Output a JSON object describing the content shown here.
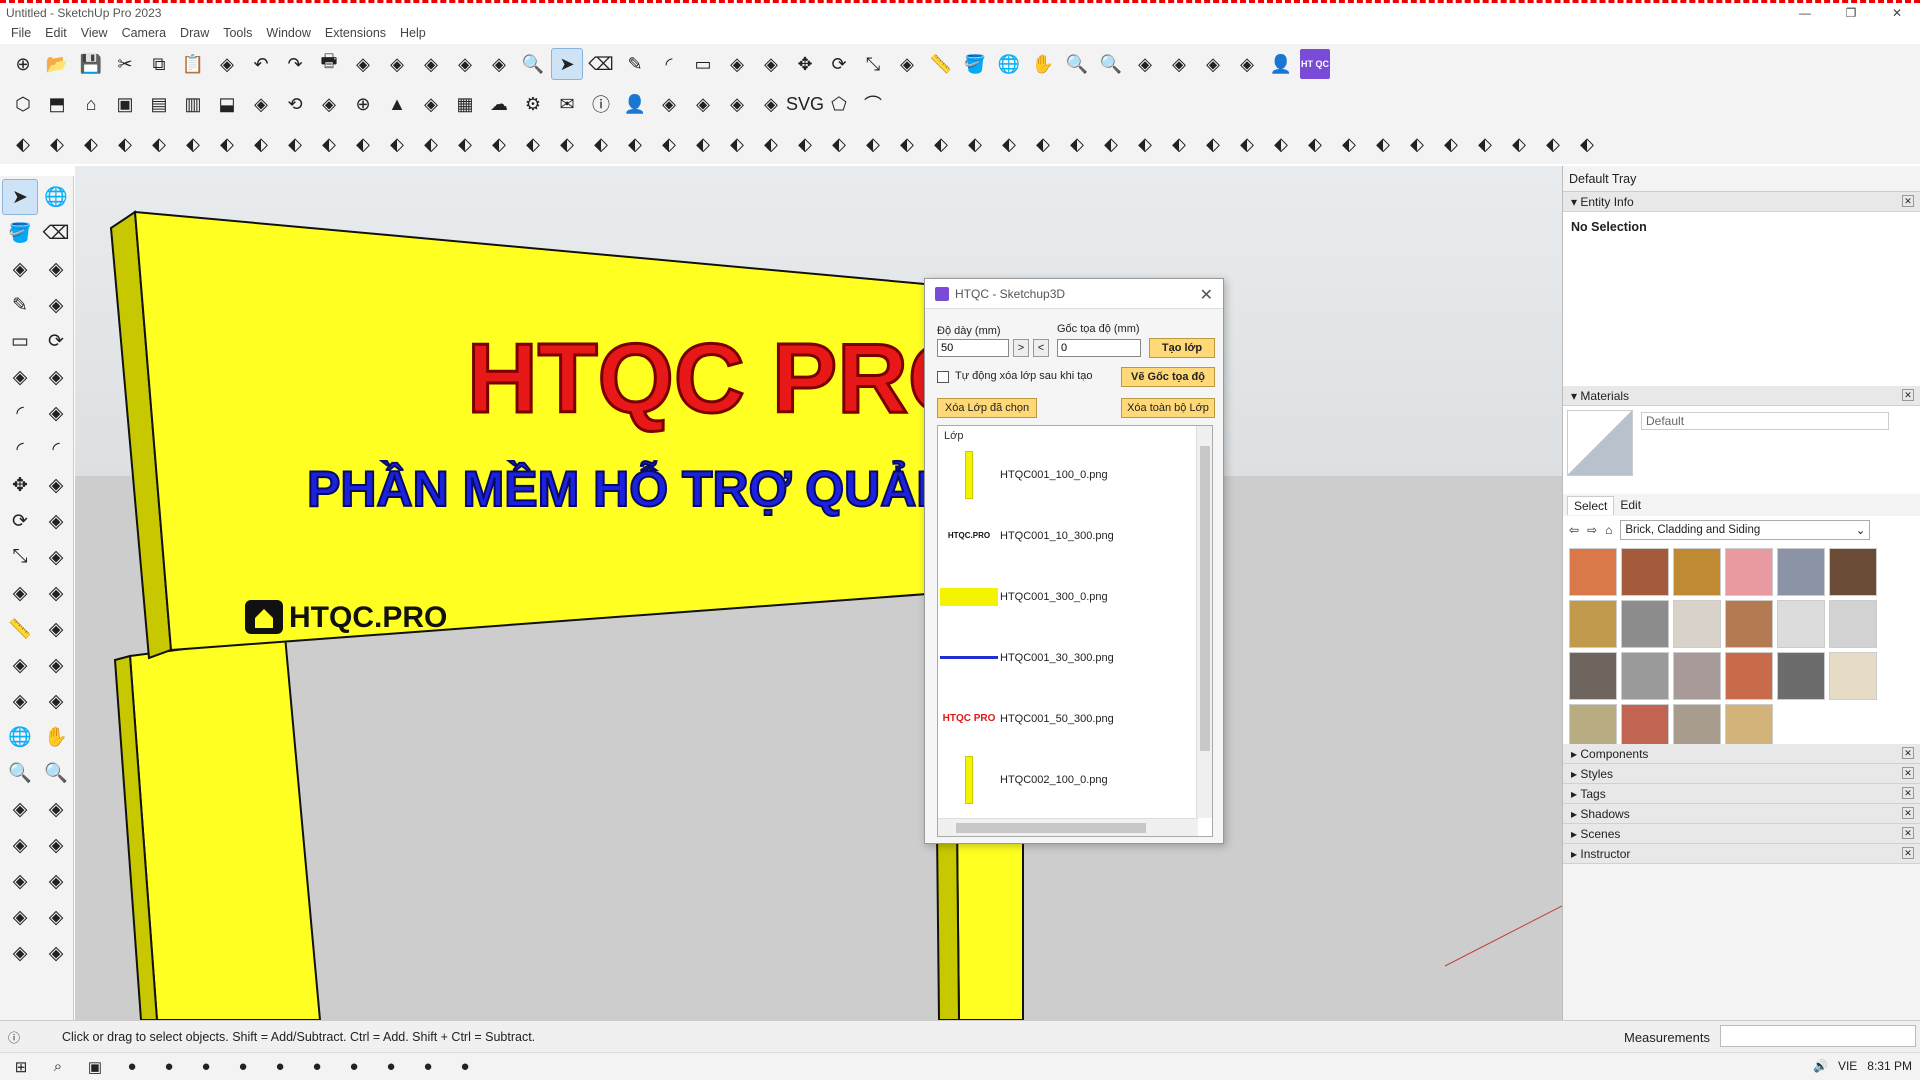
{
  "window": {
    "title": "Untitled - SketchUp Pro 2023",
    "controls": [
      "—",
      "❐",
      "✕"
    ]
  },
  "menu": [
    "File",
    "Edit",
    "View",
    "Camera",
    "Draw",
    "Tools",
    "Window",
    "Extensions",
    "Help"
  ],
  "toolbar": {
    "row1": [
      "new-icon",
      "open-icon",
      "save-icon",
      "cut-icon",
      "copy-icon",
      "paste-icon",
      "erase-icon",
      "undo-icon",
      "redo-icon",
      "print-icon",
      "model-info-icon",
      "htqc-a-icon",
      "htqc-b-icon",
      "htqc-c-icon",
      "htqc-d-icon",
      "zoom-icon",
      "select-icon",
      "eraser-icon",
      "line-icon",
      "arc-icon",
      "rectangle-icon",
      "push-pull-icon",
      "follow-me-icon",
      "move-icon",
      "rotate-icon",
      "scale-icon",
      "offset-icon",
      "tape-icon",
      "paint-icon",
      "orbit-icon",
      "pan-icon",
      "zoom-window-icon",
      "zoom-extents-icon",
      "htqc-e-icon",
      "htqc-f-icon",
      "htqc-g-icon",
      "htqc-h-icon",
      "account-icon",
      "htqc-logo-icon"
    ],
    "row2": [
      "iso-icon",
      "top-icon",
      "front-icon",
      "right-icon",
      "back-icon",
      "left-icon",
      "bottom-icon",
      "htqc-i-icon",
      "refresh-icon",
      "htqc-j-icon",
      "add-icon",
      "tree-icon",
      "htqc-k-icon",
      "checker-icon",
      "cloud-icon",
      "gear-icon",
      "mail-icon",
      "info-icon",
      "user-icon",
      "htqc-l-icon",
      "htqc-m-icon",
      "htqc-n-icon",
      "htqc-o-icon",
      "svg-icon",
      "shape-icon",
      "curve-icon"
    ],
    "row3_count": 47,
    "htqc_logo": "HT QC"
  },
  "left_tools": [
    "select-icon",
    "orbit-icon",
    "paint-icon",
    "eraser-icon",
    "component-icon",
    "pencil-icon",
    "line-icon",
    "freehand-icon",
    "rectangle-icon",
    "rotated-rect-icon",
    "circle-icon",
    "polygon-icon",
    "arc-icon",
    "pie-icon",
    "arc2-icon",
    "arc3-icon",
    "move-icon",
    "pushpull-icon",
    "rotate-icon",
    "followme-icon",
    "scale-icon",
    "offset-icon",
    "axes-icon",
    "solid-icon",
    "tape-icon",
    "dimension-icon",
    "protractor-icon",
    "text-icon",
    "axes2-icon",
    "3dtext-icon",
    "orbit2-icon",
    "pan-icon",
    "zoom-icon",
    "zoomwin-icon",
    "extents-icon",
    "prev-icon",
    "position-icon",
    "walk-icon",
    "lookaround-icon",
    "section-icon",
    "htqc-a-icon",
    "htqc-b-icon",
    "htqc-c-icon",
    "htqc-d-icon"
  ],
  "sign": {
    "title": "HTQC PRO",
    "subtitle": "PHẦN MỀM HỖ TRỢ QUẢNG",
    "website": "HTQC.PRO"
  },
  "dialog": {
    "title": "HTQC - Sketchup3D",
    "thickness_label": "Độ dày (mm)",
    "thickness_value": "50",
    "origin_label": "Gốc tọa độ (mm)",
    "origin_value": "0",
    "create_button": "Tạo lớp",
    "auto_delete_label": "Tự động xóa lớp sau khi tạo",
    "draw_origin_button": "Vẽ Gốc tọa độ",
    "delete_selected_button": "Xóa Lớp đã chọn",
    "delete_all_button": "Xóa toàn bộ Lớp",
    "list_header": "Lớp",
    "layers": [
      {
        "name": "HTQC001_100_0.png",
        "thumb": "bar"
      },
      {
        "name": "HTQC001_10_300.png",
        "thumb": "logo",
        "thumb_text": "HTQC.PRO"
      },
      {
        "name": "HTQC001_300_0.png",
        "thumb": "rect"
      },
      {
        "name": "HTQC001_30_300.png",
        "thumb": "subtitle"
      },
      {
        "name": "HTQC001_50_300.png",
        "thumb": "title",
        "thumb_text": "HTQC PRO"
      },
      {
        "name": "HTQC002_100_0.png",
        "thumb": "bar"
      }
    ]
  },
  "tray": {
    "title": "Default Tray",
    "entity_info": "Entity Info",
    "no_selection": "No Selection",
    "materials": "Materials",
    "material_name": "Default",
    "tab_select": "Select",
    "tab_edit": "Edit",
    "collection": "Brick, Cladding and Siding",
    "swatches": [
      "#d9794a",
      "#a35b3c",
      "#c08a34",
      "#e89aa0",
      "#8a94a6",
      "#6a4b36",
      "#c19a4e",
      "#8c8c8c",
      "#d8d2c8",
      "#b47a52",
      "#dcdcdc",
      "#d2d2d2",
      "#6e655e",
      "#9a9a9a",
      "#a89a98",
      "#c86a4c",
      "#6c6c6c",
      "#e6dcc6",
      "#b8ac82",
      "#c26452",
      "#a89c8e",
      "#d2b47a"
    ],
    "collapsed": [
      "Components",
      "Styles",
      "Tags",
      "Shadows",
      "Scenes",
      "Instructor"
    ]
  },
  "status": {
    "hint": "Click or drag to select objects. Shift = Add/Subtract. Ctrl = Add. Shift + Ctrl = Subtract.",
    "measurements": "Measurements"
  },
  "taskbar": {
    "lang": "VIE",
    "time": "8:31 PM"
  }
}
